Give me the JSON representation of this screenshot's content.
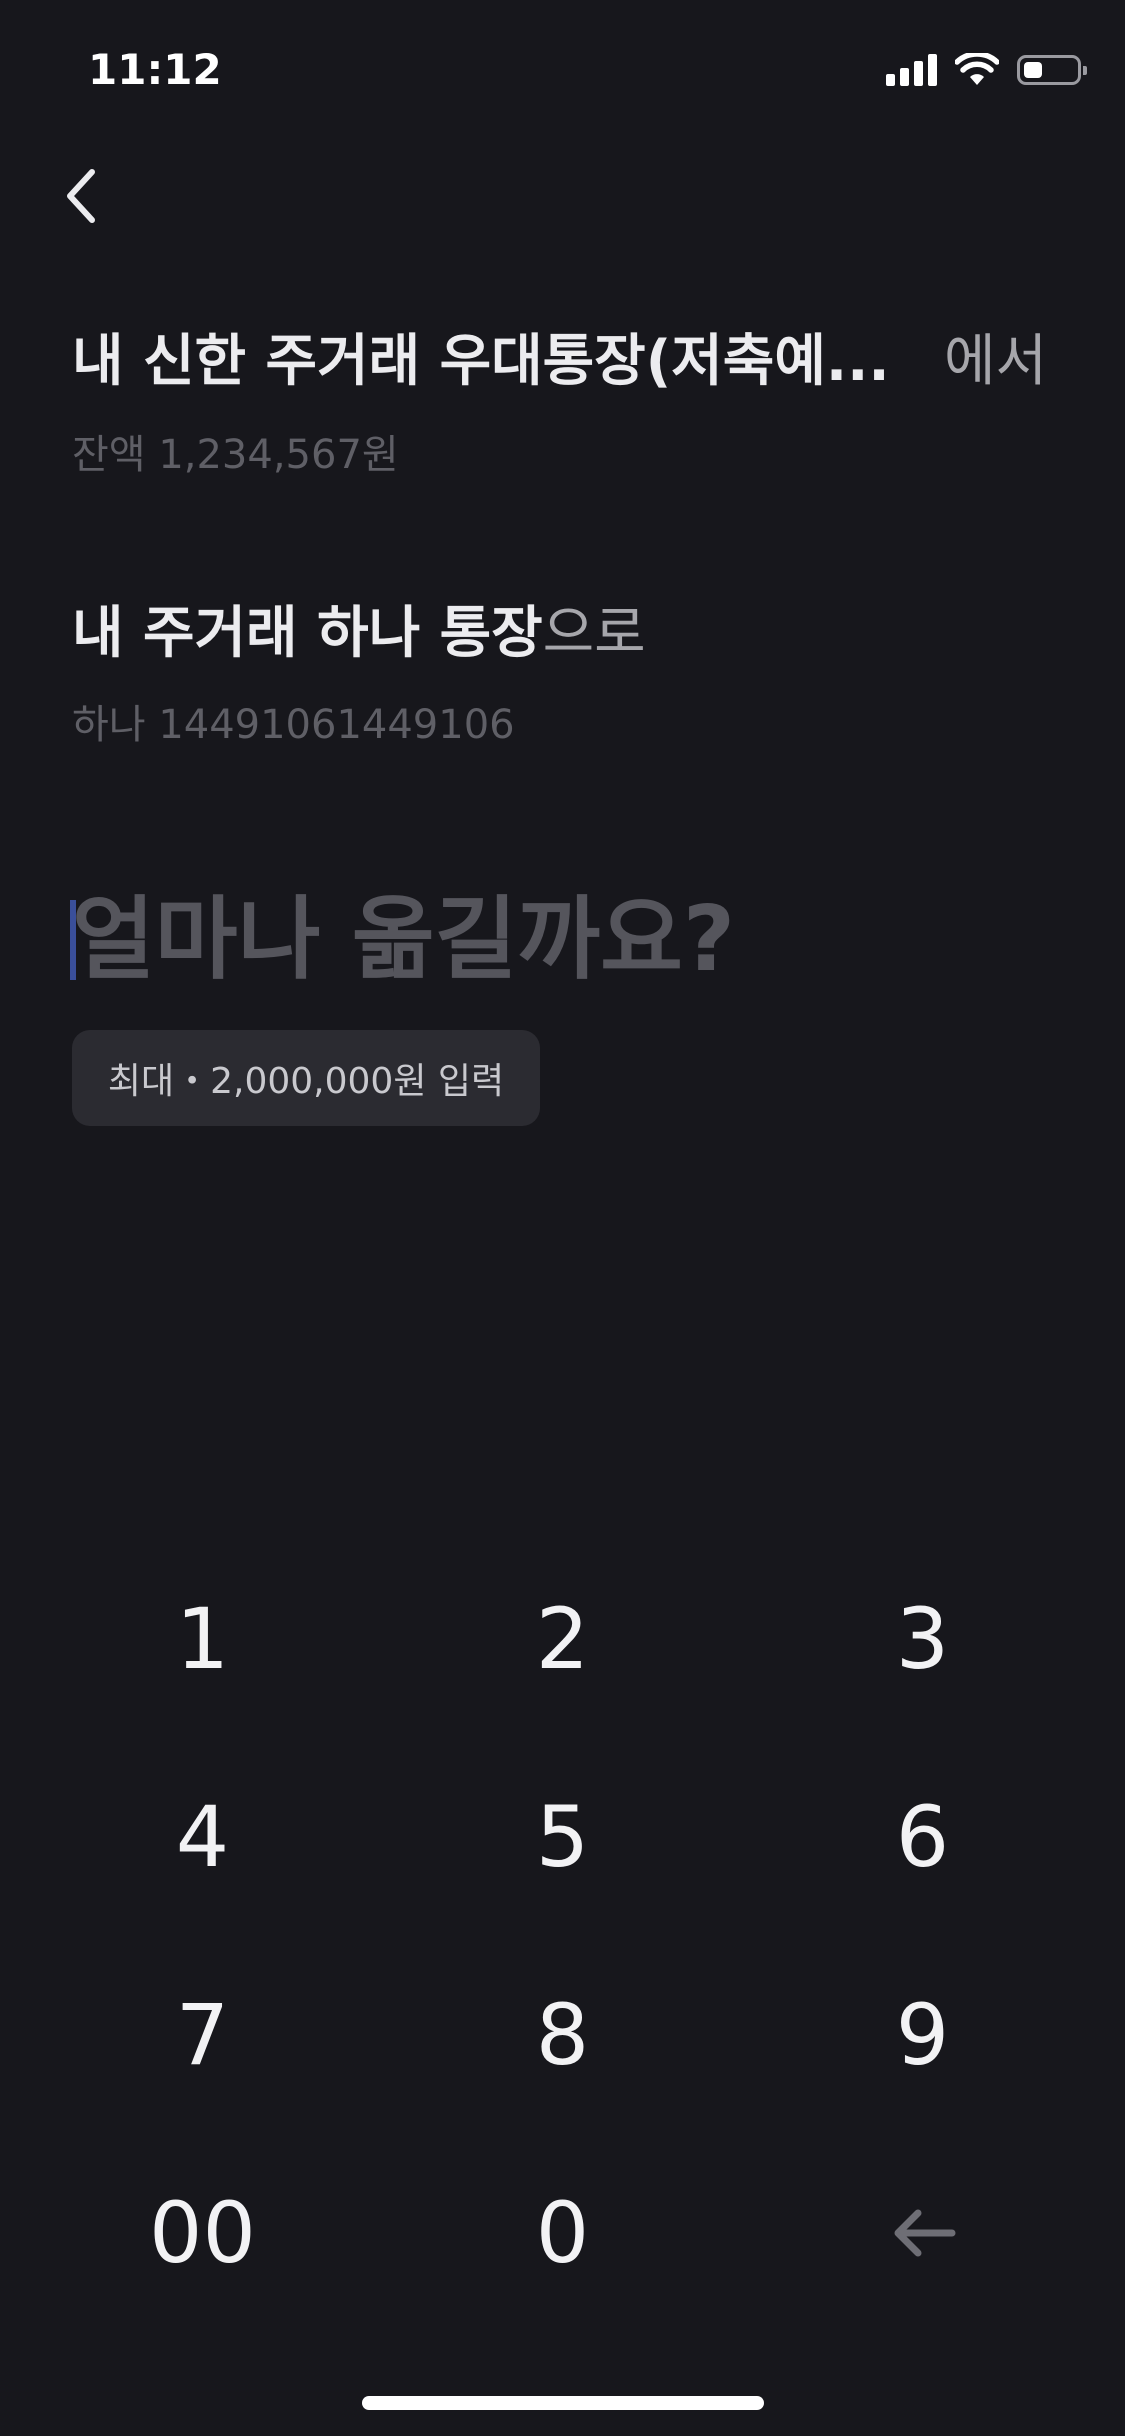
{
  "status_bar": {
    "time": "11:12"
  },
  "from_account": {
    "name": "내 신한 주거래 우대통장(저축예...",
    "suffix": "에서",
    "balance": "잔액 1,234,567원"
  },
  "to_account": {
    "name": "내 주거래 하나 통장",
    "suffix": "으로",
    "account": "하나 14491061449106"
  },
  "amount": {
    "prompt": "얼마나 옮길까요?",
    "max_button_label": "최대・2,000,000원 입력"
  },
  "keypad": {
    "keys": [
      "1",
      "2",
      "3",
      "4",
      "5",
      "6",
      "7",
      "8",
      "9",
      "00",
      "0"
    ],
    "backspace_icon": "backspace-arrow-icon"
  },
  "icons": {
    "back": "chevron-left-icon",
    "signal": "cellular-signal-icon",
    "wifi": "wifi-icon",
    "battery": "battery-icon"
  },
  "colors": {
    "background": "#17171c",
    "primary_text": "#ececef",
    "secondary_text": "#5f5f66",
    "prompt_text": "#55555c",
    "chip_background": "#2b2b31",
    "caret": "#3a4f9a"
  }
}
